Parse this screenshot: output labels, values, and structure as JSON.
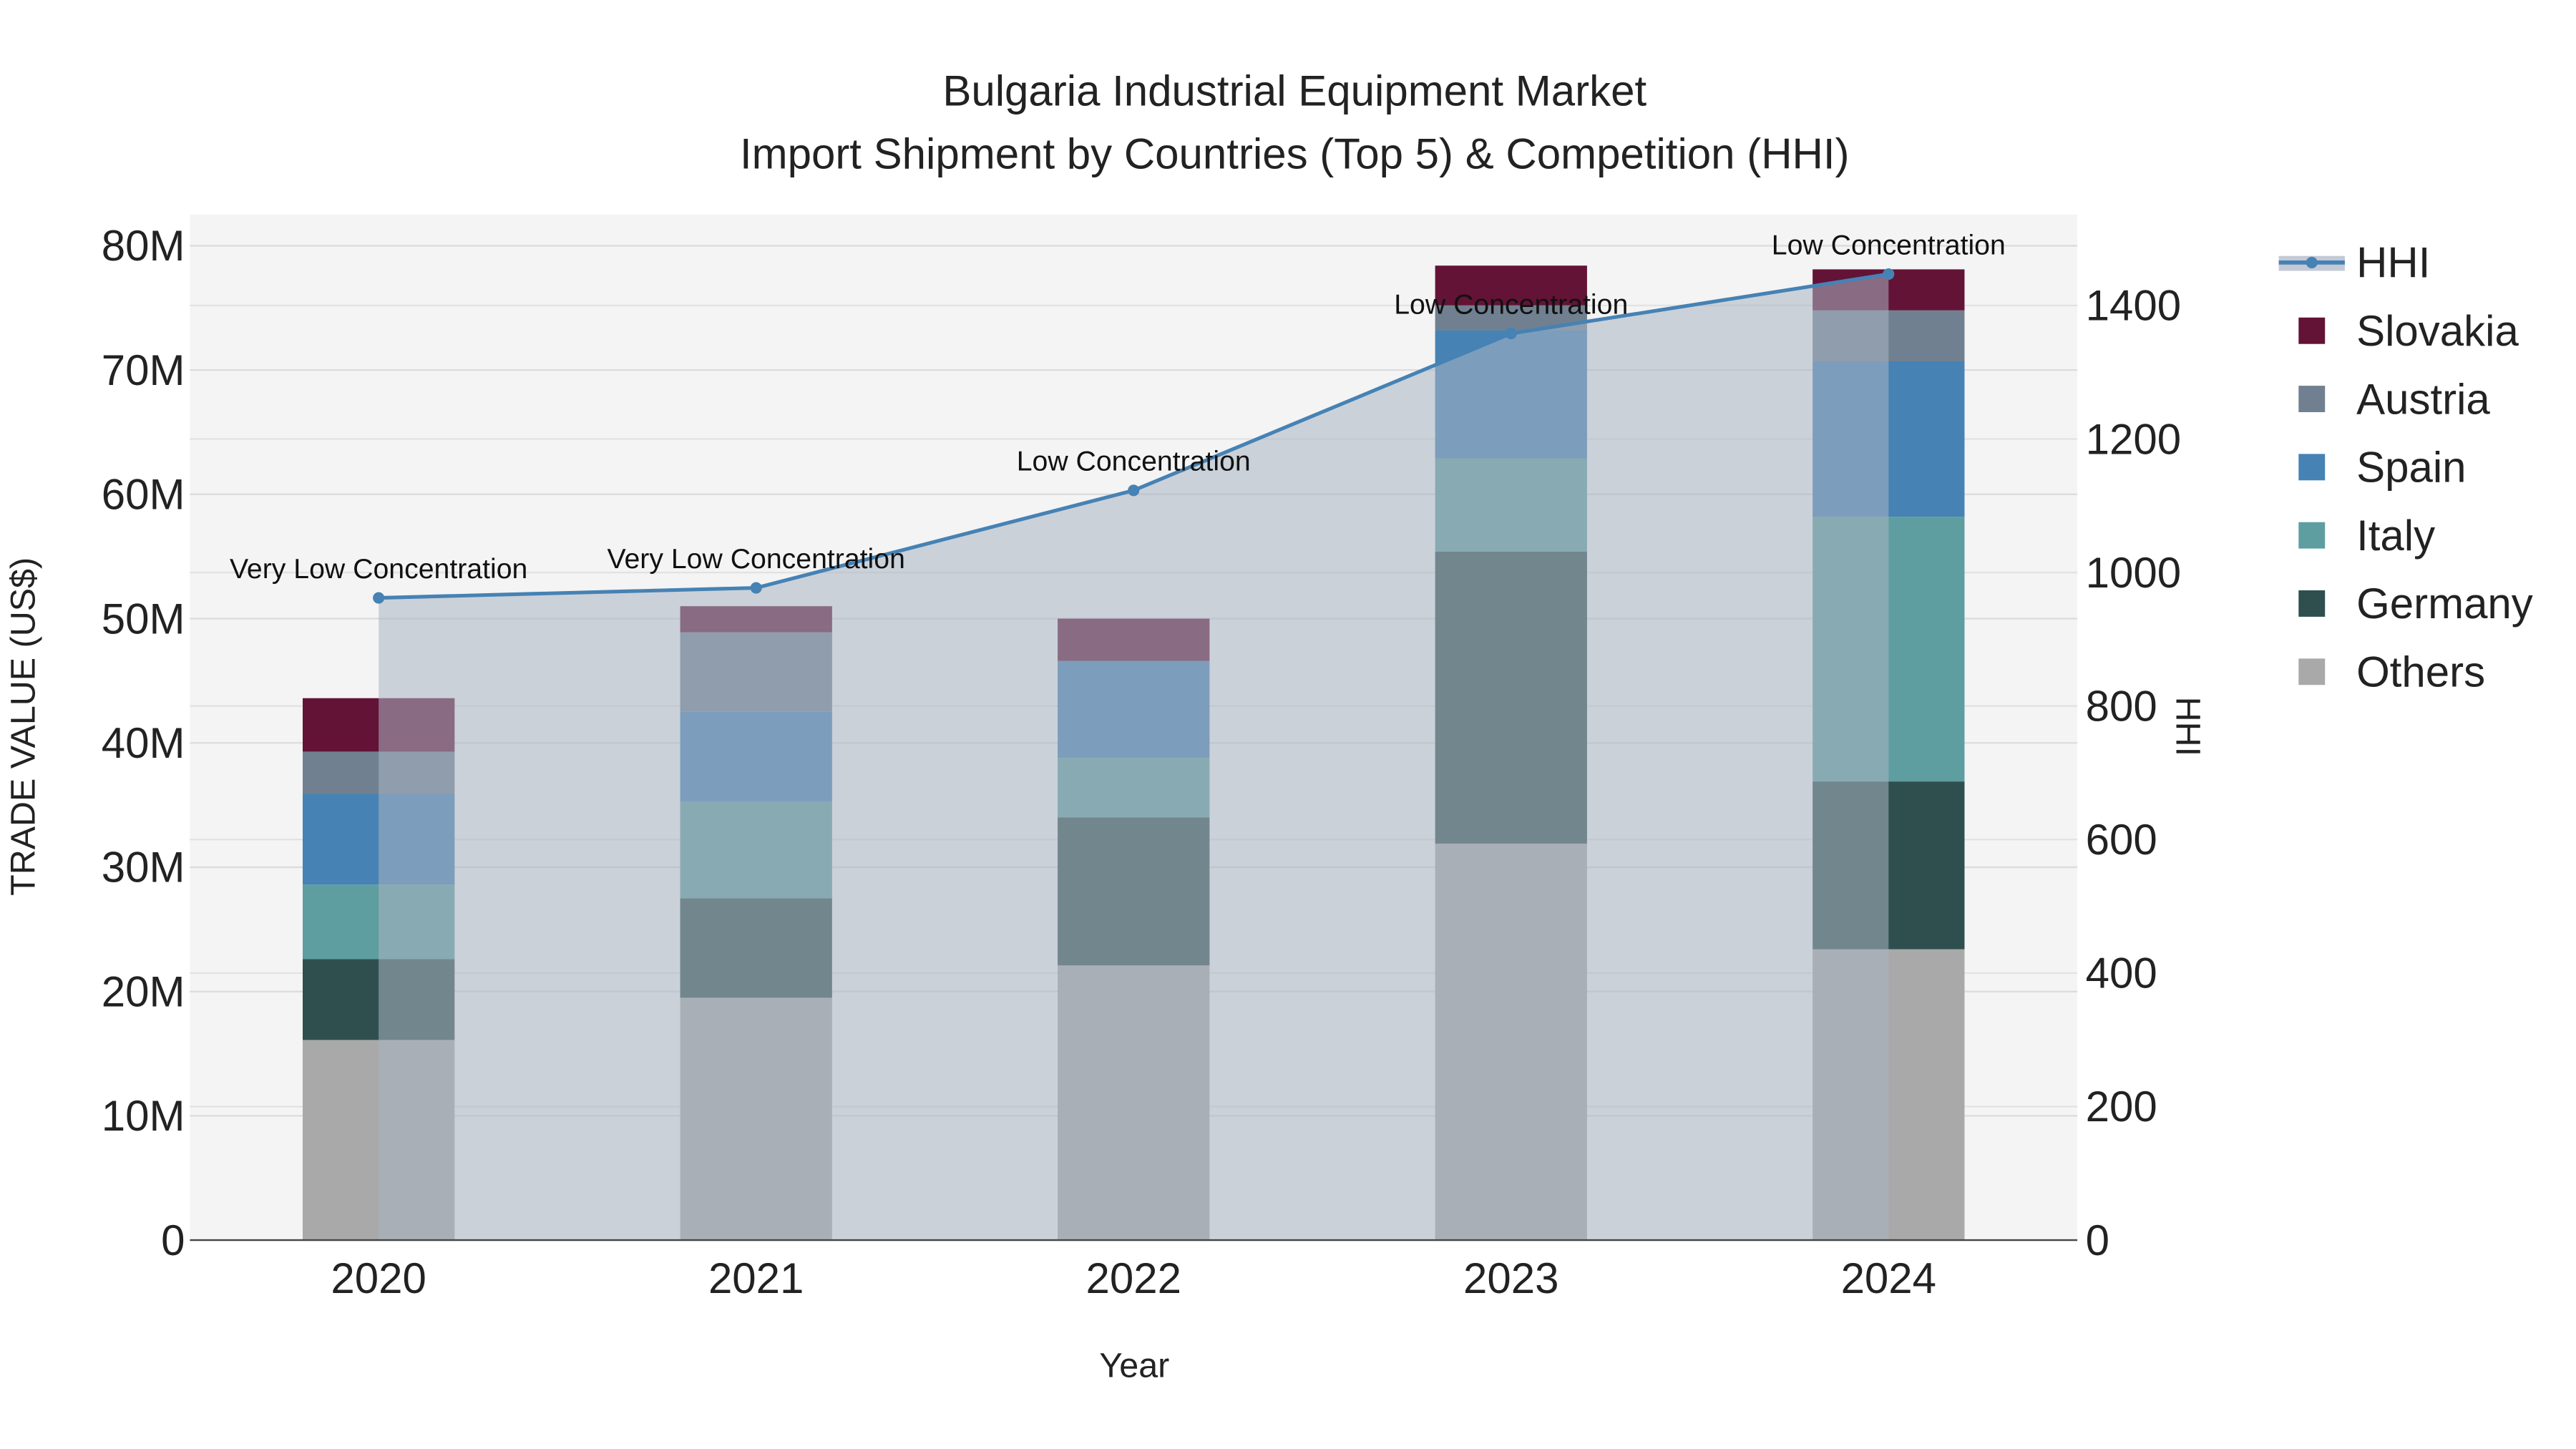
{
  "chart_data": {
    "type": "bar",
    "title_line1": "Bulgaria Industrial Equipment Market",
    "title_line2": "Import Shipment by Countries (Top 5) & Competition (HHI)",
    "xlabel": "Year",
    "ylabel": "TRADE VALUE (US$)",
    "y2label": "HHI",
    "categories": [
      "2020",
      "2021",
      "2022",
      "2023",
      "2024"
    ],
    "ylim": [
      0,
      82.5
    ],
    "y_unit": "M",
    "y_ticks": [
      0,
      10,
      20,
      30,
      40,
      50,
      60,
      70,
      80
    ],
    "y_tick_labels": [
      "0",
      "10M",
      "20M",
      "30M",
      "40M",
      "50M",
      "60M",
      "70M",
      "80M"
    ],
    "y2lim": [
      0,
      1536
    ],
    "y2_ticks": [
      0,
      200,
      400,
      600,
      800,
      1000,
      1200,
      1400
    ],
    "y2_tick_labels": [
      "0",
      "200",
      "400",
      "600",
      "800",
      "1000",
      "1200",
      "1400"
    ],
    "series": [
      {
        "name": "Others",
        "color": "#a9a9a9",
        "values": [
          16.1,
          19.5,
          22.1,
          31.9,
          23.4
        ]
      },
      {
        "name": "Germany",
        "color": "#2f4f4f",
        "values": [
          6.5,
          8.0,
          11.9,
          23.5,
          13.5
        ]
      },
      {
        "name": "Italy",
        "color": "#5f9ea0",
        "values": [
          6.0,
          7.8,
          4.8,
          7.5,
          21.3
        ]
      },
      {
        "name": "Spain",
        "color": "#4682b4",
        "values": [
          7.3,
          7.2,
          7.8,
          10.3,
          12.5
        ]
      },
      {
        "name": "Austria",
        "color": "#708090",
        "values": [
          3.4,
          6.4,
          0,
          2.0,
          4.1
        ]
      },
      {
        "name": "Slovakia",
        "color": "#631336",
        "values": [
          4.3,
          2.1,
          3.4,
          3.2,
          3.3
        ]
      }
    ],
    "hhi": {
      "name": "HHI",
      "color": "#4682b4",
      "values": [
        962,
        977,
        1123,
        1358,
        1447
      ],
      "annotations": [
        "Very Low Concentration",
        "Very Low Concentration",
        "Low Concentration",
        "Low Concentration",
        "Low Concentration"
      ]
    },
    "legend": [
      "HHI",
      "Slovakia",
      "Austria",
      "Spain",
      "Italy",
      "Germany",
      "Others"
    ],
    "legend_placement": "right",
    "grid": true
  }
}
